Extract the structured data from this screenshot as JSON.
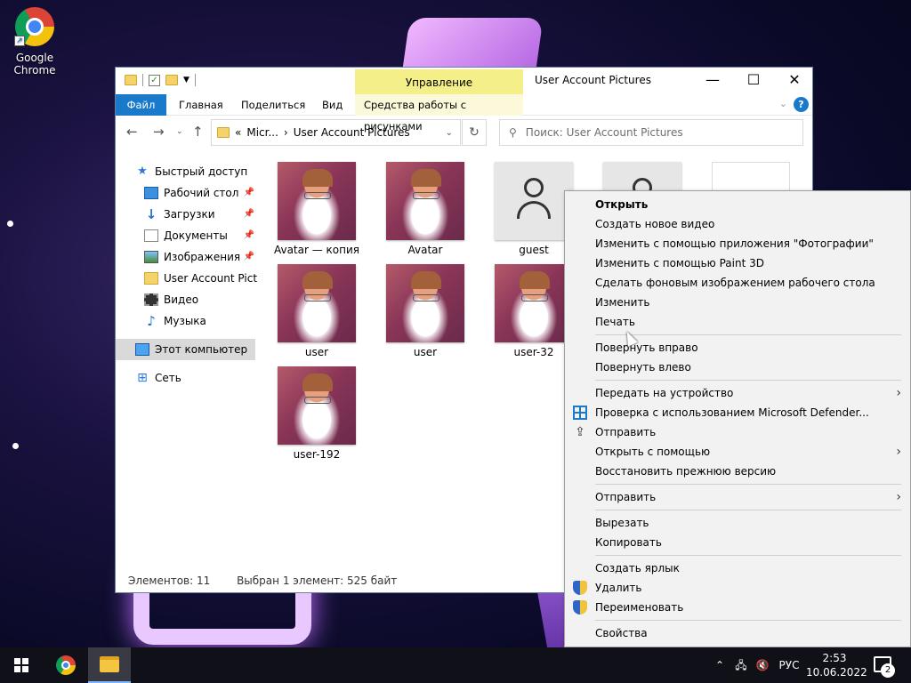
{
  "desktop": {
    "icons": [
      {
        "label": "Google Chrome",
        "icon": "chrome-icon"
      }
    ]
  },
  "window": {
    "title": "User Account Pictures",
    "quick_access_icons": [
      "folder-icon",
      "properties-icon",
      "new-folder-icon",
      "customize-dropdown-icon"
    ],
    "contextual_tab_group": "Управление",
    "ribbon_tabs": {
      "file": "Файл",
      "home": "Главная",
      "share": "Поделиться",
      "view": "Вид",
      "picture_tools": "Средства работы с рисунками"
    },
    "address": {
      "prefix": "«",
      "crumbs": [
        "Micr...",
        "User Account Pictures"
      ]
    },
    "search_placeholder": "Поиск: User Account Pictures",
    "sidebar": {
      "items": [
        {
          "label": "Быстрый доступ",
          "icon": "star-icon"
        },
        {
          "label": "Рабочий стол",
          "icon": "desktop-icon",
          "pinned": true
        },
        {
          "label": "Загрузки",
          "icon": "downloads-icon",
          "pinned": true
        },
        {
          "label": "Документы",
          "icon": "documents-icon",
          "pinned": true
        },
        {
          "label": "Изображения",
          "icon": "pictures-icon",
          "pinned": true
        },
        {
          "label": "User Account Pictur",
          "icon": "folder-icon"
        },
        {
          "label": "Видео",
          "icon": "videos-icon"
        },
        {
          "label": "Музыка",
          "icon": "music-icon"
        },
        {
          "label": "Этот компьютер",
          "icon": "this-pc-icon",
          "selected": true
        },
        {
          "label": "Сеть",
          "icon": "network-icon"
        }
      ]
    },
    "files": [
      {
        "name": "Avatar — копия",
        "kind": "avatar"
      },
      {
        "name": "Avatar",
        "kind": "avatar"
      },
      {
        "name": "guest",
        "kind": "guest"
      },
      {
        "name": "",
        "kind": "guest"
      },
      {
        "name": "",
        "kind": "file"
      },
      {
        "name": "user",
        "kind": "avatar"
      },
      {
        "name": "user",
        "kind": "avatar"
      },
      {
        "name": "user-32",
        "kind": "avatar"
      },
      {
        "name": "user-192",
        "kind": "avatar"
      }
    ],
    "status": {
      "count": "Элементов: 11",
      "selection": "Выбран 1 элемент: 525 байт"
    }
  },
  "context_menu": {
    "groups": [
      [
        {
          "label": "Открыть",
          "bold": true
        },
        {
          "label": "Создать новое видео"
        },
        {
          "label": "Изменить с помощью приложения \"Фотографии\""
        },
        {
          "label": "Изменить с помощью Paint 3D"
        },
        {
          "label": "Сделать фоновым изображением рабочего стола"
        },
        {
          "label": "Изменить"
        },
        {
          "label": "Печать"
        }
      ],
      [
        {
          "label": "Повернуть вправо"
        },
        {
          "label": "Повернуть влево"
        }
      ],
      [
        {
          "label": "Передать на устройство",
          "submenu": true
        },
        {
          "label": "Проверка с использованием Microsoft Defender...",
          "icon": "defender-icon"
        },
        {
          "label": "Отправить",
          "icon": "share-icon"
        },
        {
          "label": "Открыть с помощью",
          "submenu": true
        },
        {
          "label": "Восстановить прежнюю версию"
        }
      ],
      [
        {
          "label": "Отправить",
          "submenu": true
        }
      ],
      [
        {
          "label": "Вырезать"
        },
        {
          "label": "Копировать"
        }
      ],
      [
        {
          "label": "Создать ярлык"
        },
        {
          "label": "Удалить",
          "icon": "uac-shield-icon"
        },
        {
          "label": "Переименовать",
          "icon": "uac-shield-icon"
        }
      ],
      [
        {
          "label": "Свойства"
        }
      ]
    ]
  },
  "taskbar": {
    "language": "РУС",
    "time": "2:53",
    "date": "10.06.2022",
    "notifications": "2"
  }
}
